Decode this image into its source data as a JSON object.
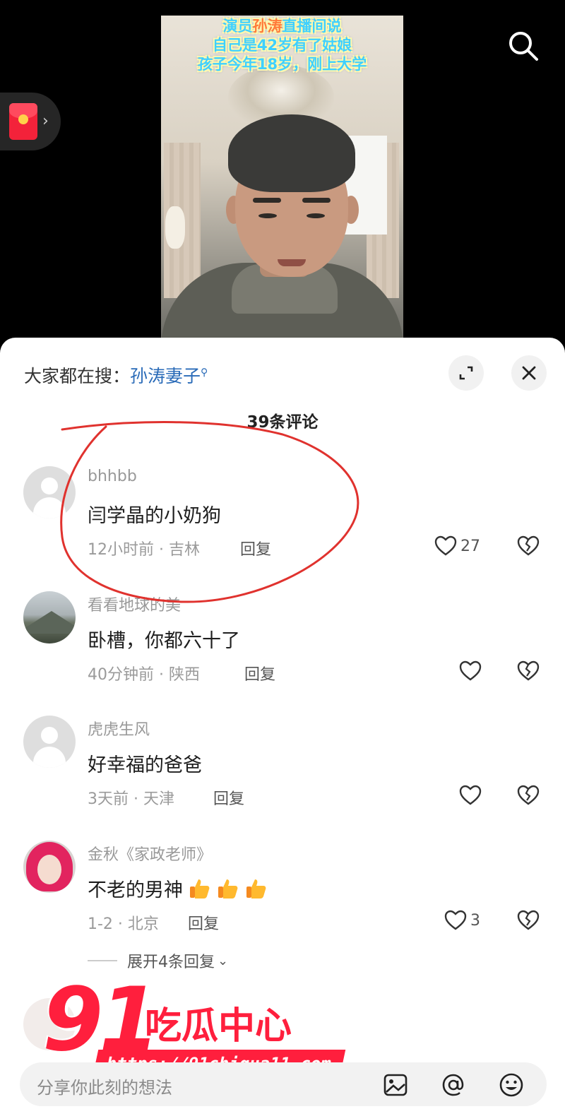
{
  "video": {
    "caption_line1_pre": "演员",
    "caption_line1_hl": "孙涛",
    "caption_line1_post": "直播间说",
    "caption_line2": "自己是42岁有了姑娘",
    "caption_line3": "孩子今年18岁，刚上大学"
  },
  "top_bar": {
    "search_icon": "search-icon",
    "red_packet_icon": "red-envelope-icon"
  },
  "sheet": {
    "hot_search_prefix": "大家都在搜：",
    "hot_search_keyword": "孙涛妻子",
    "comment_count": "39条评论"
  },
  "comments": [
    {
      "user": "bhhbb",
      "text": "闫学晶的小奶狗",
      "meta": "12小时前 · 吉林",
      "reply": "回复",
      "likes": "27"
    },
    {
      "user": "看看地球的美",
      "text": "卧槽，你都六十了",
      "meta": "40分钟前 · 陕西",
      "reply": "回复",
      "likes": ""
    },
    {
      "user": "虎虎生风",
      "text": "好幸福的爸爸",
      "meta": "3天前 · 天津",
      "reply": "回复",
      "likes": ""
    },
    {
      "user": "金秋《家政老师》",
      "text": "不老的男神",
      "meta": "1-2 · 北京",
      "reply": "回复",
      "likes": "3"
    }
  ],
  "more_replies": "展开4条回复",
  "watermark": {
    "num": "91",
    "cn": "吃瓜中心",
    "url": "https://91chigua11.com"
  },
  "input": {
    "placeholder": "分享你此刻的想法"
  },
  "colors": {
    "accent_link": "#2a6bb8",
    "annotation_red": "#e0322e",
    "watermark_red": "#ff1f3d"
  }
}
